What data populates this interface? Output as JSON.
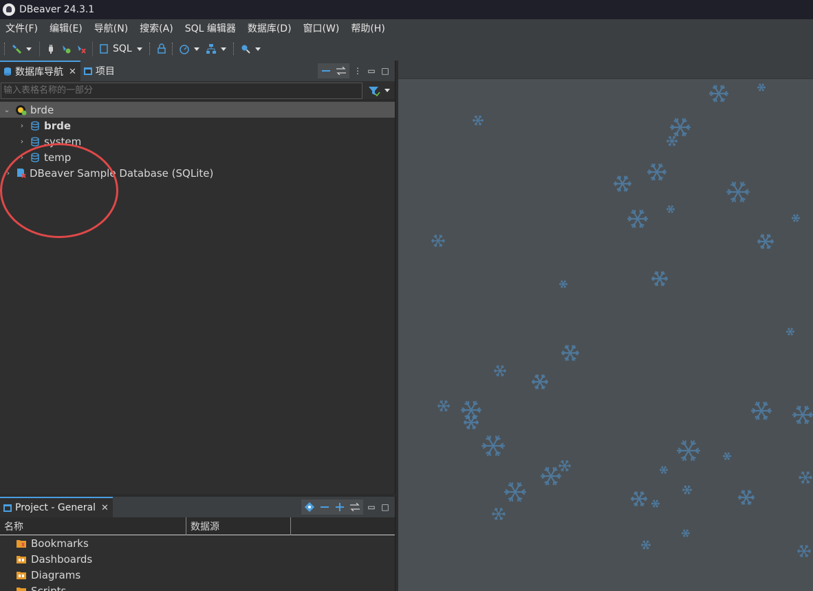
{
  "window": {
    "title": "DBeaver 24.3.1"
  },
  "menu": [
    "文件(F)",
    "编辑(E)",
    "导航(N)",
    "搜索(A)",
    "SQL 编辑器",
    "数据库(D)",
    "窗口(W)",
    "帮助(H)"
  ],
  "toolbar": {
    "sql_label": "SQL"
  },
  "navigator": {
    "tabs": [
      {
        "label": "数据库导航",
        "closable": true,
        "active": true
      },
      {
        "label": "项目",
        "closable": false,
        "active": false
      }
    ],
    "filter_placeholder": "输入表格名称的一部分",
    "tree": {
      "root": {
        "label": "brde",
        "expanded": true,
        "selected": true
      },
      "children": [
        {
          "label": "brde",
          "bold": true
        },
        {
          "label": "system",
          "bold": false
        },
        {
          "label": "temp",
          "bold": false
        }
      ],
      "other": {
        "label": "DBeaver Sample Database (SQLite)"
      }
    }
  },
  "project": {
    "tab_label": "Project - General",
    "columns": [
      "名称",
      "数据源"
    ],
    "items": [
      "Bookmarks",
      "Dashboards",
      "Diagrams",
      "Scripts"
    ]
  },
  "colors": {
    "accent": "#4a9fe0",
    "annotation": "#e04848",
    "flake": "#4f7fa8"
  }
}
